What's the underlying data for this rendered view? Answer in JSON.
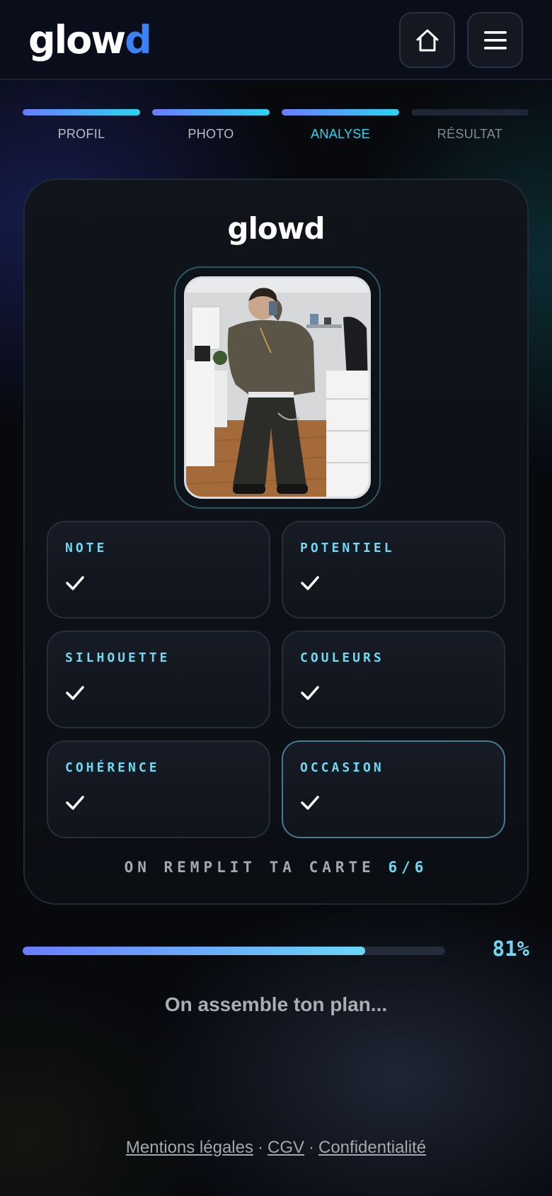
{
  "header": {
    "logo_main": "glow",
    "logo_accent": "d",
    "home_icon": "home-icon",
    "menu_icon": "hamburger-menu-icon"
  },
  "steps": [
    {
      "label": "PROFIL",
      "state": "done"
    },
    {
      "label": "PHOTO",
      "state": "done"
    },
    {
      "label": "ANALYSE",
      "state": "active"
    },
    {
      "label": "RÉSULTAT",
      "state": "pending"
    }
  ],
  "card": {
    "title": "glowd",
    "tiles": [
      {
        "label": "NOTE",
        "icon": "check-icon",
        "highlight": false
      },
      {
        "label": "POTENTIEL",
        "icon": "check-icon",
        "highlight": false
      },
      {
        "label": "SILHOUETTE",
        "icon": "check-icon",
        "highlight": false
      },
      {
        "label": "COULEURS",
        "icon": "check-icon",
        "highlight": false
      },
      {
        "label": "COHÉRENCE",
        "icon": "check-icon",
        "highlight": false
      },
      {
        "label": "OCCASION",
        "icon": "check-icon",
        "highlight": true
      }
    ],
    "fill_text": "ON REMPLIT TA CARTE",
    "fill_count": "6/6"
  },
  "progress": {
    "value": 0.81,
    "label": "81%",
    "status": "On assemble ton plan..."
  },
  "footer": {
    "links": [
      "Mentions légales",
      "CGV",
      "Confidentialité"
    ],
    "separator": "·"
  },
  "colors": {
    "accent_cyan": "#6fd8f2",
    "accent_blue": "#3b82f6",
    "gradient_start": "#6b7cff",
    "gradient_end": "#2bd5ef"
  }
}
